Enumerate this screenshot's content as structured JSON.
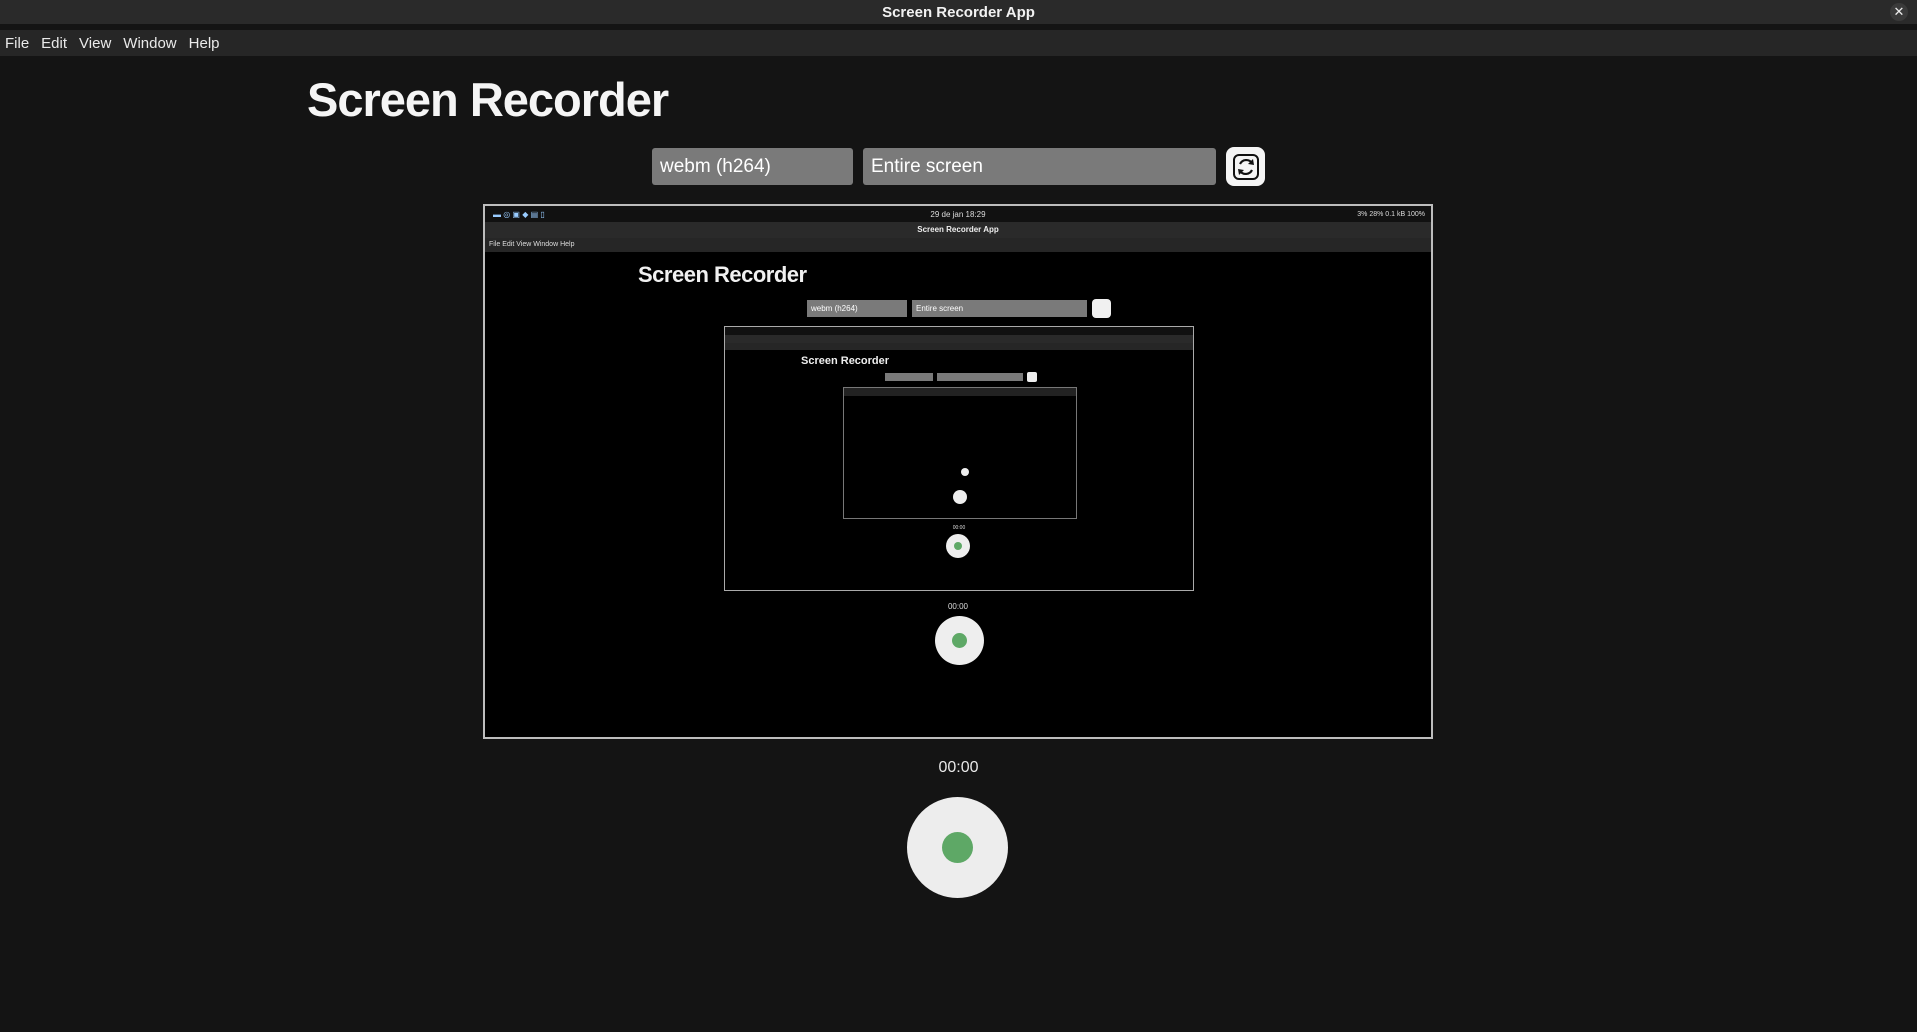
{
  "window": {
    "title": "Screen Recorder App",
    "close_glyph": "✕"
  },
  "menu": [
    "File",
    "Edit",
    "View",
    "Window",
    "Help"
  ],
  "page": {
    "title": "Screen Recorder"
  },
  "controls": {
    "format_value": "webm (h264)",
    "source_value": "Entire screen"
  },
  "preview": {
    "topbar": {
      "clock": "29 de jan  18:29",
      "tray": "3%   28%   0.1 kB      100%"
    },
    "title": "Screen Recorder App",
    "menu": "File   Edit   View   Window   Help",
    "heading": "Screen Recorder",
    "format_value": "webm (h264)",
    "source_value": "Entire screen",
    "timer": "00:00"
  },
  "recorder": {
    "timer": "00:00"
  },
  "colors": {
    "accent_green": "#5ea866",
    "bg": "#141414"
  }
}
